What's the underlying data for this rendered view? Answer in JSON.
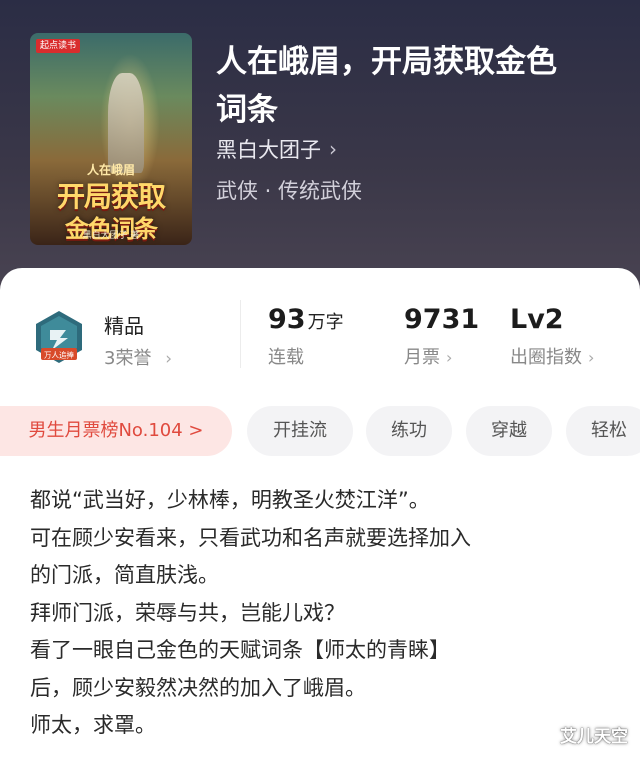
{
  "book": {
    "title_line1": "人在峨眉，开局获取金色",
    "title_line2": "词条",
    "author": "黑白大团子",
    "genre": "武侠 · 传统武侠"
  },
  "cover": {
    "badge": "起点读书",
    "title_small": "人在峨眉",
    "title_big_line1": "开局获取",
    "title_big_line2": "金色词条",
    "author": "黑白大团子 著"
  },
  "honor": {
    "title": "精品",
    "subtitle": "3荣誉",
    "icon": "laurel-badge-icon",
    "badge_text": "万人追捧"
  },
  "stats": [
    {
      "value": "93",
      "unit": "万字",
      "label": "连载",
      "chevron": false
    },
    {
      "value": "9731",
      "unit": "",
      "label": "月票",
      "chevron": true
    },
    {
      "value": "Lv2",
      "unit": "",
      "label": "出圈指数",
      "chevron": true
    }
  ],
  "tags": [
    {
      "label": "男生月票榜No.104 >",
      "kind": "rank"
    },
    {
      "label": "开挂流",
      "kind": "plain"
    },
    {
      "label": "练功",
      "kind": "plain"
    },
    {
      "label": "穿越",
      "kind": "plain"
    },
    {
      "label": "轻松",
      "kind": "plain"
    }
  ],
  "synopsis": [
    "都说“武当好，少林棒，明教圣火焚江洋”。",
    "可在顾少安看来，只看武功和名声就要选择加入",
    "的门派，简直肤浅。",
    "拜师门派，荣辱与共，岂能儿戏？",
    "看了一眼自己金色的天赋词条【师太的青睐】",
    "后，顾少安毅然决然的加入了峨眉。",
    "师太，求罩。"
  ],
  "watermark": "艾儿天空",
  "colors": {
    "hero_bg": "#2f2f45",
    "rank_tag_bg": "#fde6e4",
    "rank_tag_text": "#e04a3e",
    "plain_tag_bg": "#f3f3f5"
  }
}
